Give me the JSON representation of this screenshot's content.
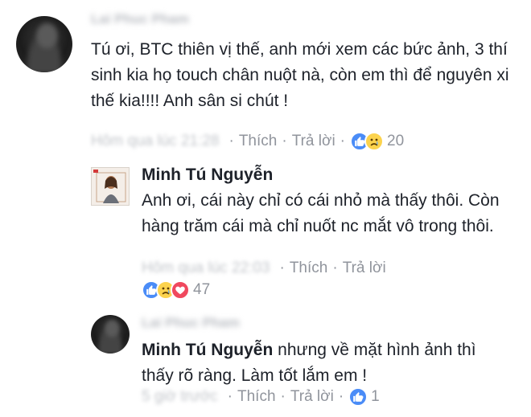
{
  "comments": [
    {
      "author": "Lai Phuc Pham",
      "text": "Tú ơi, BTC thiên vị thế, anh mới xem các bức ảnh, 3 thí sinh kia họ touch chân nuột nà, còn em thì để nguyên xi thế kia!!!! Anh sân si  chút !",
      "time": "Hôm qua lúc 21:28",
      "like_label": "Thích",
      "reply_label": "Trả lời",
      "reaction_count": "20"
    },
    {
      "author": "Minh Tú Nguyễn",
      "text": "Anh ơi, cái này chỉ có cái nhỏ mà thấy thôi. Còn hàng trăm cái mà chỉ nuốt nc mắt vô trong thôi.",
      "time": "Hôm qua lúc 22:03",
      "like_label": "Thích",
      "reply_label": "Trả lời",
      "reaction_count": "47"
    },
    {
      "author": "Lai Phuc Pham",
      "mention": "Minh Tú Nguyễn",
      "text": "nhưng về mặt hình ảnh thì thấy rõ ràng. Làm tốt lắm em !",
      "time": "5 giờ trước",
      "like_label": "Thích",
      "reply_label": "Trả lời",
      "reaction_count": "1"
    }
  ],
  "icons": {
    "like": "thumbs-up-icon",
    "sad": "sad-face-icon",
    "love": "heart-icon"
  },
  "colors": {
    "like": "#4a8cf7",
    "sad": "#fcd34d",
    "love": "#f0485e",
    "meta": "#90949c",
    "text": "#1d2129"
  }
}
